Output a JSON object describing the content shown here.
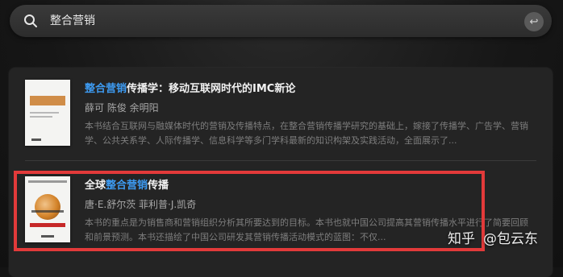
{
  "search": {
    "query": "整合营销",
    "return_key": "↩"
  },
  "results": [
    {
      "title_before": "",
      "title_highlight": "整合营销",
      "title_after": "传播学：移动互联网时代的IMC新论",
      "authors": "薛可 陈俊 余明阳",
      "description": "本书结合互联网与融媒体时代的营销及传播特点，在整合营销传播学研究的基础上，嫁接了传播学、广告学、营销学、公共关系学、人际传播学、信息科学等多门学科最新的知识构架及实践活动，全面展示了..."
    },
    {
      "title_before": "全球",
      "title_highlight": "整合营销",
      "title_after": "传播",
      "authors": "唐·E.舒尔茨 菲利普·J.凯奇",
      "description": "本书的重点是为销售商和营销组织分析其所要达到的目标。本书也就中国公司提高其营销传播水平进行了简要回顾和前景预测。本书还描绘了中国公司研发其营销传播活动模式的蓝图：不仅..."
    }
  ],
  "watermark": {
    "site": "知乎",
    "handle": "@包云东"
  },
  "colors": {
    "highlight": "#3d9bf2",
    "frame": "#e23a3a"
  }
}
